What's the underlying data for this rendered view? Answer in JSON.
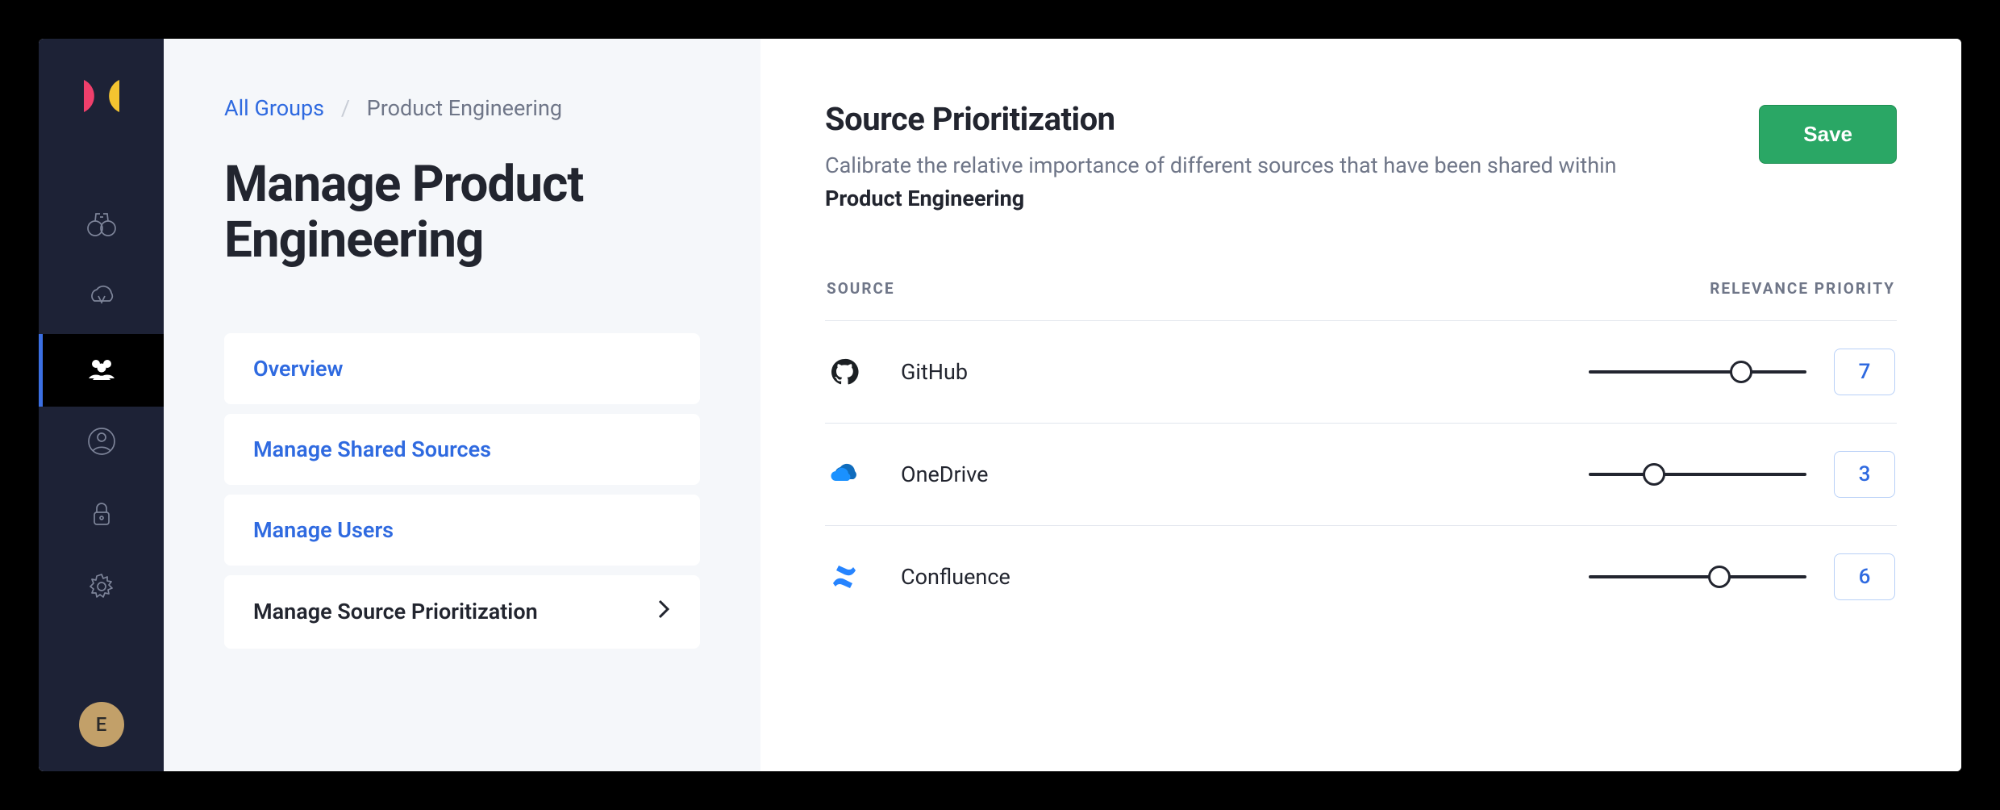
{
  "avatar_initial": "E",
  "breadcrumb": {
    "root": "All Groups",
    "current": "Product Engineering"
  },
  "page_title": "Manage Product Engineering",
  "menu": {
    "items": [
      {
        "label": "Overview"
      },
      {
        "label": "Manage Shared Sources"
      },
      {
        "label": "Manage Users"
      },
      {
        "label": "Manage Source Prioritization",
        "current": true
      }
    ]
  },
  "section": {
    "title": "Source Prioritization",
    "desc_pre": "Calibrate the relative importance of different sources that have been shared within ",
    "desc_bold": "Product Engineering",
    "save_label": "Save"
  },
  "table": {
    "col_source": "Source",
    "col_priority": "Relevance Priority",
    "rows": [
      {
        "name": "GitHub",
        "icon": "github",
        "value": 7,
        "max": 10
      },
      {
        "name": "OneDrive",
        "icon": "onedrive",
        "value": 3,
        "max": 10
      },
      {
        "name": "Confluence",
        "icon": "confluence",
        "value": 6,
        "max": 10
      }
    ]
  }
}
